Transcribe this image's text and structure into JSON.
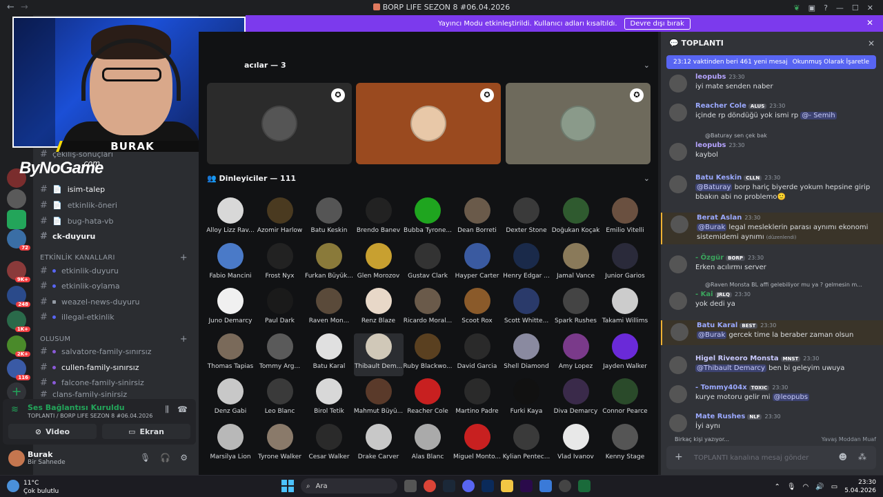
{
  "window": {
    "title": "BORP LIFE SEZON 8 #06.04.2026",
    "controls": [
      "—",
      "☐",
      "✕"
    ]
  },
  "banner": {
    "text": "Yayıncı Modu etkinleştirildi. Kullanıcı adları kısaltıldı.",
    "button": "Devre dışı bırak"
  },
  "server_badges": [
    "72",
    "9K+",
    "248",
    "1K+",
    "2K+",
    "116"
  ],
  "stream": {
    "cam_name": "BURAK",
    "brand": "ByNoGame",
    "brand_suffix": ".com"
  },
  "channels": {
    "items": [
      {
        "label": "çekiliş-sonuçları",
        "bright": false
      },
      {
        "label": "isim-talep",
        "bright": true,
        "icon": "📄"
      },
      {
        "label": "etkinlik-öneri",
        "bright": false,
        "icon": "📄"
      },
      {
        "label": "bug-hata-vb",
        "bright": false,
        "icon": "📄"
      },
      {
        "label": "ck-duyuru",
        "bright": true
      }
    ],
    "category_events": "ETKİNLİK KANALLARI",
    "events": [
      "etkinlik-duyuru",
      "etkinlik-oylama",
      "weazel-news-duyuru",
      "illegal-etkinlik"
    ],
    "category_families": "OLUSUM",
    "families": [
      {
        "label": "salvatore-family-sınırsız",
        "bright": false
      },
      {
        "label": "cullen-family-sınırsız",
        "bright": true
      },
      {
        "label": "falcone-family-sinirsiz",
        "bright": false
      },
      {
        "label": "clans-family-sinirsiz",
        "bright": false
      }
    ]
  },
  "voice": {
    "status": "Ses Bağlantısı Kuruldu",
    "location": "TOPLANTI / BORP LIFE SEZON 8 #06.04.2026",
    "video_label": "Video",
    "screen_label": "Ekran"
  },
  "user": {
    "name": "Burak",
    "status": "Bir Sahnede"
  },
  "stage": {
    "speakers_header": "acılar — 3",
    "speaker_colors": [
      "#2b2b2b",
      "#9a4a1f",
      "#6e6a5c"
    ],
    "listeners_header": "Dinleyiciler — 111",
    "listeners": [
      "Alloy Lizz Rav...",
      "Azomir Harlow",
      "Batu Keskin",
      "Brendo Banev",
      "Bubba Tyrone...",
      "Dean Borreti",
      "Dexter Stone",
      "Doğukan Koçak",
      "Emilio Vitelli",
      "Fabio Mancini",
      "Frost Nyx",
      "Furkan Büyük...",
      "Glen Morozov",
      "Gustav Clark",
      "Hayper Carter",
      "Henry Edgar ...",
      "Jamal Vance",
      "Junior Garios",
      "Juno Demarcy",
      "Paul Dark",
      "Raven Mon...",
      "Renz Blaze",
      "Ricardo Moral...",
      "Scoot Rox",
      "Scott Whitte...",
      "Spark Rushes",
      "Takami Willims",
      "Thomas Tapias",
      "Tommy Arg...",
      "Batu Karal",
      "Thibault Dem...",
      "Ruby Blackwo...",
      "David Garcia",
      "Shell Diamond",
      "Amy Lopez",
      "Jayden Walker",
      "Denz Gabi",
      "Leo Blanc",
      "Birol Tetik",
      "Mahmut Büyü...",
      "Reacher Cole",
      "Martino Padre",
      "Furki Kaya",
      "Diva Demarcy",
      "Connor Pearce",
      "Marsilya Lion",
      "Tyrone Walker",
      "Cesar Walker",
      "Drake Carver",
      "Alas Blanc",
      "Miguel Monto...",
      "Kylian Pentec...",
      "Vlad İvanov",
      "Kenny Stage"
    ],
    "avatar_colors": [
      "#d8d8d8",
      "#4a3a20",
      "#555",
      "#222",
      "#1fa51f",
      "#6a5a4a",
      "#3a3a3a",
      "#2f5a2f",
      "#6a5040",
      "#4a7ac8",
      "#222",
      "#8a7a3a",
      "#c8a030",
      "#333",
      "#3a5aa0",
      "#1a2a4a",
      "#8a7a5a",
      "#2a2a3a",
      "#f0f0f0",
      "#1a1a1a",
      "#5a4a3a",
      "#e8d8c8",
      "#6a5a4a",
      "#8a5a2a",
      "#2a3a6a",
      "#444",
      "#ccc",
      "#7a6a5a",
      "#5a5a5a",
      "#e0e0e0",
      "#d0c8b8",
      "#5a4020",
      "#2a2a2a",
      "#8a8aa0",
      "#7a3a8a",
      "#6a2ad8",
      "#c8c8c8",
      "#3a3a3a",
      "#d8d8d8",
      "#5a3a2a",
      "#c82020",
      "#2a2a2a",
      "#111",
      "#3a2a4a",
      "#2a4a2a",
      "#b8b8b8",
      "#8a7a6a",
      "#2a2a2a",
      "#c8c8c8",
      "#aaa",
      "#c82020",
      "#3a3a3a",
      "#e8e8e8",
      "#555"
    ]
  },
  "chat": {
    "header": "TOPLANTI",
    "new_messages": "23:12 vaktinden beri 461 yeni mesaj",
    "mark_read": "Okunmuş Olarak İşaretle",
    "messages": [
      {
        "name": "leopubs",
        "color": "#b5a4ff",
        "time": "23:30",
        "text": "iyi mate senden naber",
        "tag": ""
      },
      {
        "name": "Reacher Cole",
        "color": "#9ba9ff",
        "time": "23:30",
        "text": "içinde rp döndüğü yok ismi rp ",
        "mention": "@- Semih",
        "tag": "ALUS"
      },
      {
        "reply": "@Baturay sen çek bak",
        "name": "leopubs",
        "color": "#b5a4ff",
        "time": "23:30",
        "text": "kaybol",
        "tag": ""
      },
      {
        "name": "Batu Keskin",
        "color": "#9ba9ff",
        "time": "23:30",
        "mention": "@Baturay",
        "text": " borp hariç biyerde yokum hepsine girip bbakın abi no problemo🙂",
        "tag": "CLLN"
      },
      {
        "name": "Berat Aslan",
        "color": "#9ba9ff",
        "time": "23:30",
        "mention": "@Burak",
        "text": " legal mesleklerin parası aynımı ekonomi sistemidemi aynımı",
        "edited": "(düzenlendi)",
        "tag": ""
      },
      {
        "name": "- Özgür",
        "color": "#3ba55d",
        "time": "23:30",
        "text": "Erken acılırmı server",
        "tag": "BORP"
      },
      {
        "reply": "@Raven Monsta BL affi gelebiliyor mu ya ? gelmesin m...",
        "name": "- Kai",
        "color": "#3ba55d",
        "time": "23:30",
        "text": "yok dedi ya",
        "tag": "JRLQ"
      },
      {
        "name": "Batu Karal",
        "color": "#9ba9ff",
        "time": "23:30",
        "mention": "@Burak",
        "text": " gercek time la beraber zaman olsun",
        "tag": "BEST"
      },
      {
        "name": "Higel Riveoro Monsta",
        "color": "#c9c9ff",
        "time": "23:30",
        "mention": "@Thibault Demarcy",
        "text": " ben bi geleyim uwuya",
        "tag": "MNST"
      },
      {
        "name": "- Tommy404x",
        "color": "#9ba9ff",
        "time": "23:30",
        "text": "kurye motoru gelir mi ",
        "mention_after": "@leopubs",
        "tag": "TOXIC"
      },
      {
        "name": "Mate Rushes",
        "color": "#9ba9ff",
        "time": "23:30",
        "text": "İyi aynı",
        "tag": "NLF"
      }
    ],
    "typing": "Birkaç kişi yazıyor...",
    "slowmode": "Yavaş Moddan Muaf",
    "input_placeholder": "TOPLANTI kanalına mesaj gönder"
  },
  "taskbar": {
    "temp": "11°C",
    "weather": "Çok bulutlu",
    "search_label": "Ara",
    "time": "23:30",
    "date": "5.04.2026"
  }
}
